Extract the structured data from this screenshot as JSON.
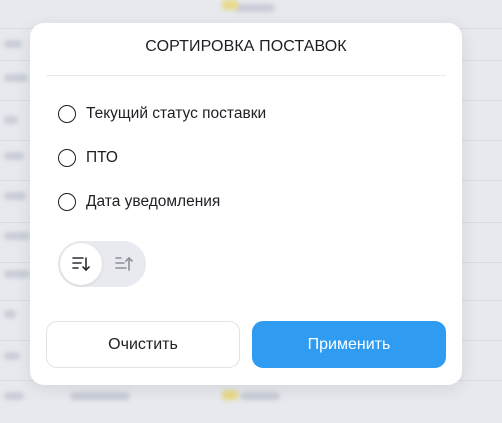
{
  "modal": {
    "title": "СОРТИРОВКА ПОСТАВОК",
    "options": [
      {
        "label": "Текущий статус поставки",
        "selected": false
      },
      {
        "label": "ПТО",
        "selected": false
      },
      {
        "label": "Дата уведомления",
        "selected": false
      }
    ],
    "sort_direction": {
      "active": "descending",
      "buttons": [
        {
          "icon": "sort-descending-icon"
        },
        {
          "icon": "sort-ascending-icon"
        }
      ]
    },
    "clear_label": "Очистить",
    "apply_label": "Применить"
  },
  "colors": {
    "accent": "#2f9cf2",
    "text": "#1d1f24",
    "toggle_bg": "#e8eaef",
    "backdrop": "#e7e9ee"
  }
}
